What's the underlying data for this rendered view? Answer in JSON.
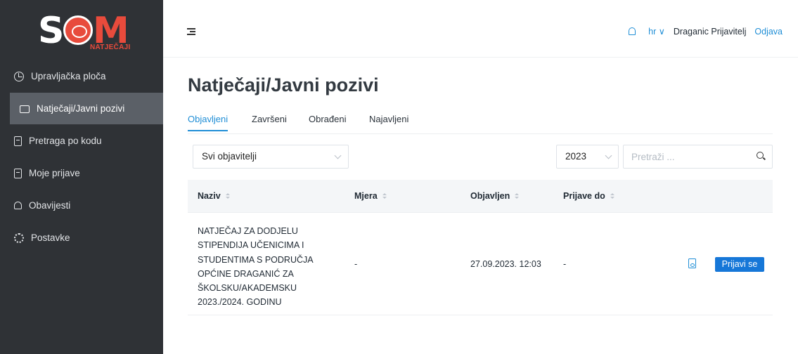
{
  "brand": {
    "logo_text": "SOM",
    "logo_sub": "NATJEČAJI"
  },
  "sidebar": {
    "items": [
      {
        "label": "Upravljačka ploča",
        "icon": "dashboard-icon"
      },
      {
        "label": "Natječaji/Javni pozivi",
        "icon": "folder-open-icon",
        "active": true
      },
      {
        "label": "Pretraga po kodu",
        "icon": "file-search-icon"
      },
      {
        "label": "Moje prijave",
        "icon": "file-text-icon"
      },
      {
        "label": "Obavijesti",
        "icon": "bell-icon"
      },
      {
        "label": "Postavke",
        "icon": "gear-icon"
      }
    ]
  },
  "topbar": {
    "language": "hr",
    "user_name": "Draganic Prijavitelj",
    "logout_label": "Odjava"
  },
  "page": {
    "title": "Natječaji/Javni pozivi"
  },
  "tabs": [
    {
      "label": "Objavljeni",
      "active": true
    },
    {
      "label": "Završeni"
    },
    {
      "label": "Obrađeni"
    },
    {
      "label": "Najavljeni"
    }
  ],
  "filters": {
    "publisher_selected": "Svi objavitelji",
    "year_selected": "2023",
    "search_placeholder": "Pretraži ..."
  },
  "table": {
    "columns": [
      "Naziv",
      "Mjera",
      "Objavljen",
      "Prijave do"
    ],
    "rows": [
      {
        "name": "NATJEČAJ ZA DODJELU STIPENDIJA UČENICIMA I STUDENTIMA S PODRUČJA OPĆINE DRAGANIĆ ZA ŠKOLSKU/AKADEMSKU 2023./2024. GODINU",
        "mjera": "-",
        "objavljen": "27.09.2023. 12:03",
        "prijave_do": "-",
        "action_label": "Prijavi se"
      }
    ]
  },
  "colors": {
    "sidebar_bg": "#2f3236",
    "sidebar_active": "#5b6067",
    "accent": "#1f8ed6",
    "button": "#1677d8",
    "brand_red": "#e84b3c"
  }
}
